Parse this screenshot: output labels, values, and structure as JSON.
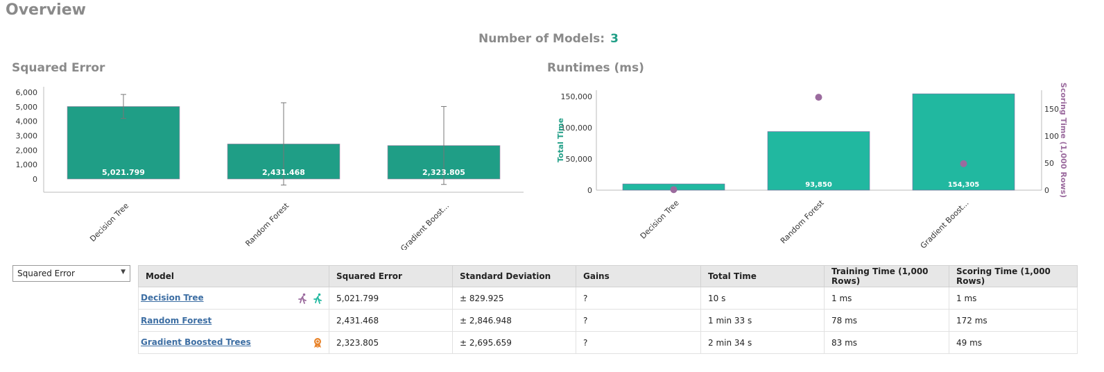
{
  "page": {
    "title": "Overview",
    "num_models_label": "Number of Models:",
    "num_models": "3"
  },
  "colors": {
    "bar": "#1f9e86",
    "bar_runtime": "#21b8a0",
    "scoring": "#9b6b9e",
    "accent": "#1f9e86",
    "link": "#3d6ea3"
  },
  "chart_data": [
    {
      "type": "bar",
      "title": "Squared Error",
      "categories": [
        "Decision Tree",
        "Random Forest",
        "Gradient Boost..."
      ],
      "values": [
        5021.799,
        2431.468,
        2323.805
      ],
      "value_labels": [
        "5,021.799",
        "2,431.468",
        "2,323.805"
      ],
      "error_bars": [
        829.925,
        2846.948,
        2695.659
      ],
      "ylim": [
        -500,
        6000
      ],
      "yticks": [
        0,
        1000,
        2000,
        3000,
        4000,
        5000,
        6000
      ],
      "ytick_labels": [
        "0",
        "1,000",
        "2,000",
        "3,000",
        "4,000",
        "5,000",
        "6,000"
      ],
      "xlabel": "",
      "ylabel": ""
    },
    {
      "type": "bar",
      "title": "Runtimes (ms)",
      "categories": [
        "Decision Tree",
        "Random Forest",
        "Gradient Boost..."
      ],
      "series": [
        {
          "name": "Total Time",
          "values": [
            10000,
            93850,
            154305
          ],
          "value_labels": [
            "",
            "93,850",
            "154,305"
          ]
        },
        {
          "name": "Scoring Time (1,000 Rows)",
          "type": "scatter",
          "values": [
            1,
            172,
            49
          ]
        }
      ],
      "ylabel": "Total Time",
      "ylabel_right": "Scoring Time (1,000 Rows)",
      "ylim": [
        0,
        160000
      ],
      "yticks": [
        0,
        50000,
        100000,
        150000
      ],
      "ytick_labels": [
        "0",
        "50,000",
        "100,000",
        "150,000"
      ],
      "ylim_right": [
        0,
        185
      ],
      "yticks_right": [
        0,
        50,
        100,
        150
      ],
      "ytick_labels_right": [
        "0",
        "50",
        "100",
        "150"
      ]
    }
  ],
  "metric_select": {
    "value": "Squared Error"
  },
  "table": {
    "headers": [
      "Model",
      "Squared Error",
      "Standard Deviation",
      "Gains",
      "Total Time",
      "Training Time (1,000 Rows)",
      "Scoring Time (1,000 Rows)"
    ],
    "rows": [
      {
        "model": "Decision Tree",
        "se": "5,021.799",
        "sd": "± 829.925",
        "gains": "?",
        "total": "10 s",
        "train": "1 ms",
        "score": "1 ms",
        "icons": [
          "fastest-training-icon",
          "fastest-scoring-icon"
        ]
      },
      {
        "model": "Random Forest",
        "se": "2,431.468",
        "sd": "± 2,846.948",
        "gains": "?",
        "total": "1 min 33 s",
        "train": "78 ms",
        "score": "172 ms",
        "icons": []
      },
      {
        "model": "Gradient Boosted Trees",
        "se": "2,323.805",
        "sd": "± 2,695.659",
        "gains": "?",
        "total": "2 min 34 s",
        "train": "83 ms",
        "score": "49 ms",
        "icons": [
          "best-model-award-icon"
        ]
      }
    ]
  }
}
